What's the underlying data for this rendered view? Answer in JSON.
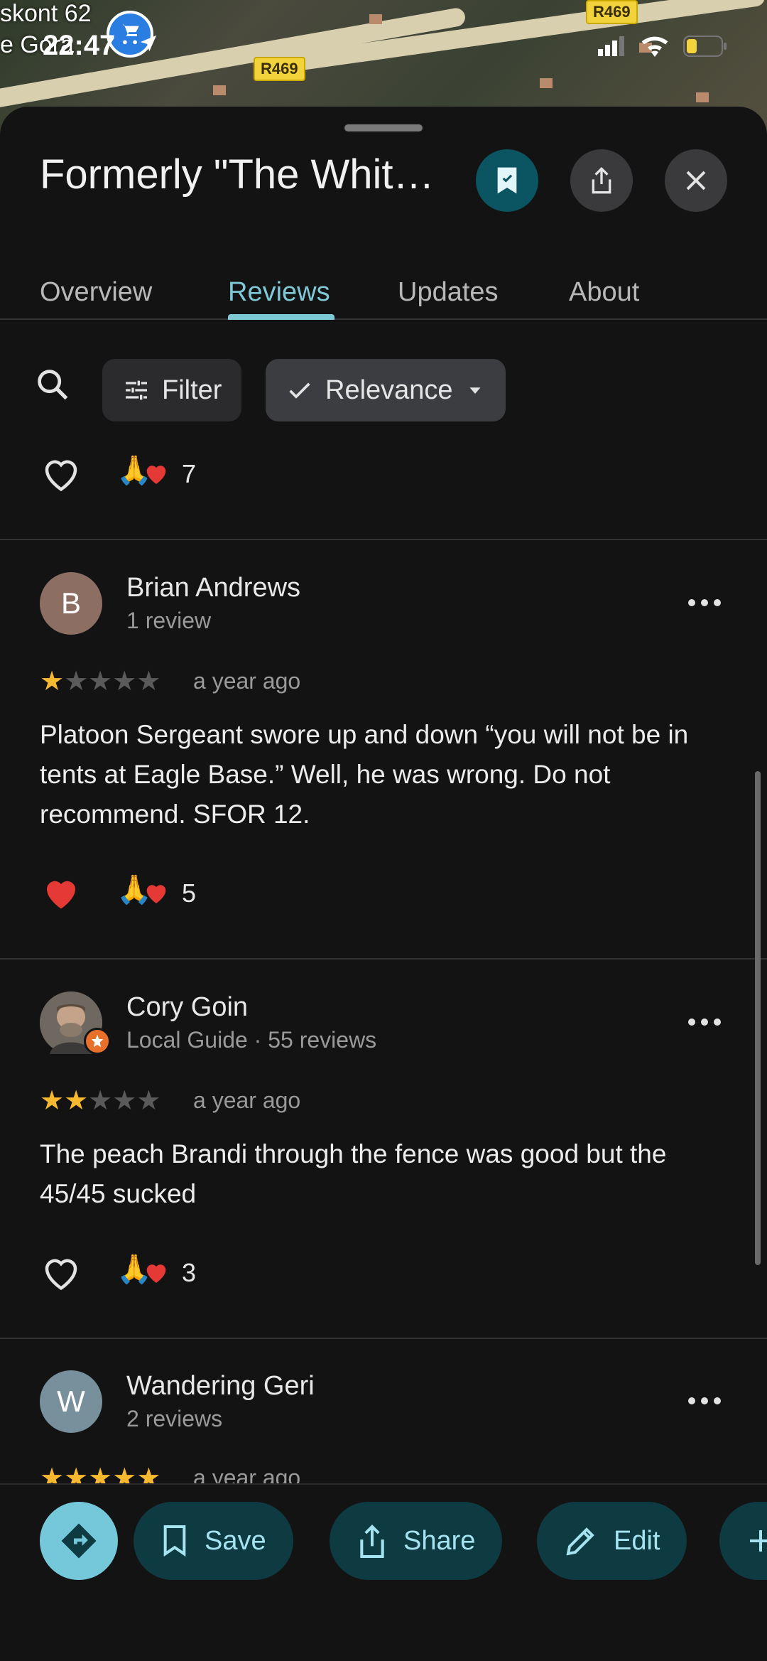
{
  "map": {
    "place_label": "skont 62",
    "place_label2": "e Gora",
    "road_tag_1": "R469",
    "road_tag_2": "R469"
  },
  "status_bar": {
    "time": "22:47"
  },
  "place": {
    "title": "Formerly \"The Whit…"
  },
  "tabs": [
    {
      "label": "Overview"
    },
    {
      "label": "Reviews"
    },
    {
      "label": "Updates"
    },
    {
      "label": "About"
    }
  ],
  "active_tab": "Reviews",
  "toolbar": {
    "filter_label": "Filter",
    "sort_label": "Relevance"
  },
  "prev_review": {
    "reaction_count": "7"
  },
  "reviews": [
    {
      "author": "Brian Andrews",
      "avatar_initial": "B",
      "avatar_color": "#8d6e63",
      "meta": "1 review",
      "rating": 1,
      "date": "a year ago",
      "text": "Platoon Sergeant swore up and down “you will not be in tents at Eagle Base.”  Well, he was wrong.  Do not recommend.  SFOR 12.",
      "liked": true,
      "reaction_count": "5"
    },
    {
      "author": "Cory Goin",
      "avatar_initial": "",
      "avatar_color": "#6b6b6b",
      "meta": "Local Guide · 55 reviews",
      "rating": 2,
      "date": "a year ago",
      "text": "The peach Brandi through the fence was good but the 45/45 sucked",
      "liked": false,
      "reaction_count": "3"
    },
    {
      "author": "Wandering Geri",
      "avatar_initial": "W",
      "avatar_color": "#78909c",
      "meta": "2 reviews",
      "rating": 5,
      "date": "a year ago"
    }
  ],
  "bottom_actions": {
    "save": "Save",
    "share": "Share",
    "edit": "Edit"
  },
  "colors": {
    "accent": "#7fc8d8",
    "star": "#f5b82e",
    "heart": "#e53935"
  }
}
